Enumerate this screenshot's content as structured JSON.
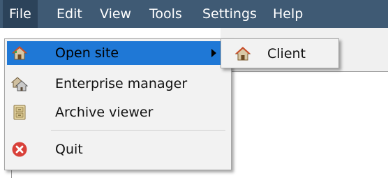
{
  "menubar": {
    "items": [
      "File",
      "Edit",
      "View",
      "Tools",
      "Settings",
      "Help"
    ],
    "active": "File"
  },
  "file_menu": {
    "items": [
      {
        "label": "Open site",
        "icon": "house-icon",
        "has_submenu": true,
        "highlighted": true
      },
      {
        "label": "Enterprise manager",
        "icon": "enterprise-house-icon",
        "has_submenu": false
      },
      {
        "label": "Archive viewer",
        "icon": "archive-cabinet-icon",
        "has_submenu": false
      },
      {
        "label": "Quit",
        "icon": "quit-icon",
        "has_submenu": false
      }
    ]
  },
  "submenu": {
    "items": [
      {
        "label": "Client",
        "icon": "house-icon"
      }
    ]
  },
  "colors": {
    "menubar_bg": "#3f5a74",
    "highlight": "#1f78d6",
    "quit_red": "#d9413a"
  }
}
